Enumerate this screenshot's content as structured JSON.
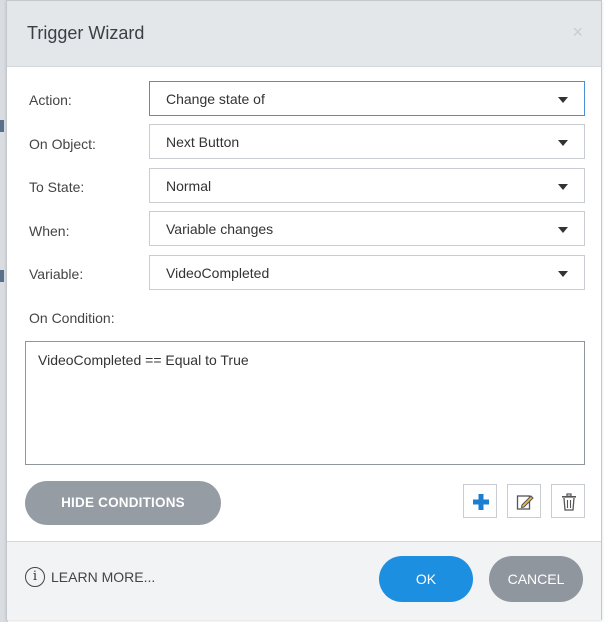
{
  "dialog": {
    "title": "Trigger Wizard",
    "close_glyph": "×"
  },
  "fields": [
    {
      "label": "Action:",
      "value": "Change state of"
    },
    {
      "label": "On Object:",
      "value": "Next Button"
    },
    {
      "label": "To State:",
      "value": "Normal"
    },
    {
      "label": "When:",
      "value": "Variable changes"
    },
    {
      "label": "Variable:",
      "value": "VideoCompleted"
    }
  ],
  "conditions": {
    "label": "On Condition:",
    "items": [
      "VideoCompleted == Equal to True"
    ],
    "hide_button": "HIDE CONDITIONS",
    "icons": [
      "plus-icon",
      "edit-icon",
      "trash-icon"
    ]
  },
  "footer": {
    "info_glyph": "i",
    "learn_more": "LEARN MORE...",
    "ok": "OK",
    "cancel": "CANCEL"
  },
  "colors": {
    "accent": "#1d8fe0",
    "plus": "#1b7fd1",
    "grey_button": "#959ca4",
    "titlebar": "#e4e7ea"
  }
}
